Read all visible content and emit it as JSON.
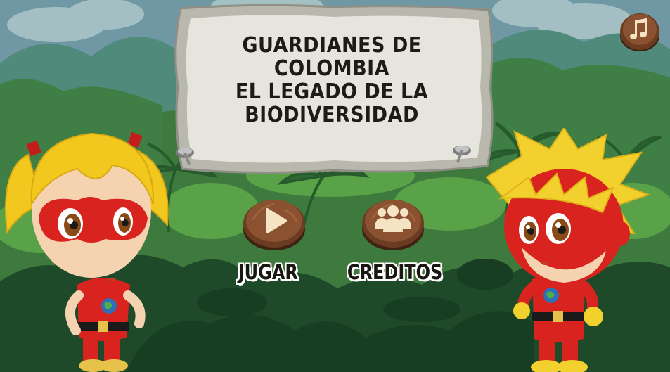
{
  "title": {
    "lines": [
      "GUARDIANES DE",
      "COLOMBIA",
      "EL LEGADO DE LA",
      "BIODIVERSIDAD"
    ]
  },
  "menu": {
    "play_label": "JUGAR",
    "credits_label": "CREDITOS"
  },
  "icons": {
    "play": "play-triangle",
    "credits": "group-of-people",
    "music": "music-note"
  },
  "colors": {
    "sky": "#6f98a4",
    "jungle_dark": "#1f4a2a",
    "jungle_mid": "#2f6a36",
    "jungle_light": "#5aa446",
    "stone": "#dcdcd2",
    "wood": "#6b3b22",
    "hero_red": "#d8231f",
    "hero_hair": "#f2c81e"
  }
}
